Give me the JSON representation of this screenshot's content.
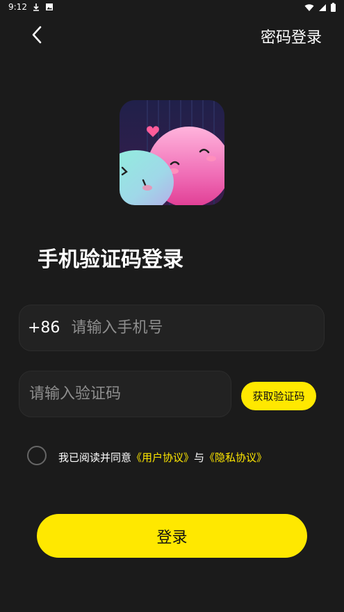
{
  "status_bar": {
    "time": "9:12",
    "left_icons": [
      "download-icon",
      "image-icon"
    ],
    "right_icons": [
      "wifi-icon",
      "signal-icon",
      "battery-icon"
    ]
  },
  "header": {
    "back_icon": "chevron-left-icon",
    "switch_link": "密码登录"
  },
  "title": "手机验证码登录",
  "phone": {
    "country_code": "+86",
    "placeholder": "请输入手机号"
  },
  "code": {
    "placeholder": "请输入验证码",
    "button": "获取验证码"
  },
  "agreement": {
    "prefix": "我已阅读并同意",
    "user_link": "《用户协议》",
    "and": "与",
    "privacy_link": "《隐私协议》"
  },
  "login_button": "登录",
  "colors": {
    "background": "#1b1b1b",
    "accent": "#ffe800",
    "field": "#222222"
  }
}
